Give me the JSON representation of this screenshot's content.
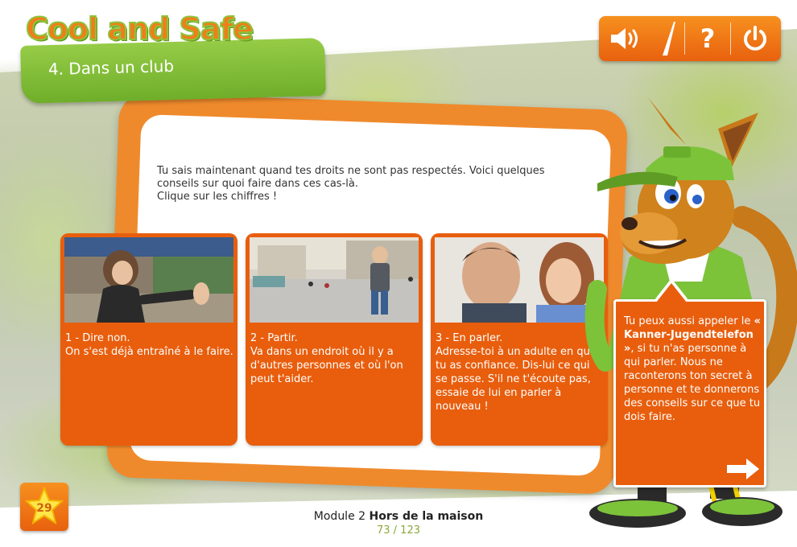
{
  "header": {
    "logo_text": "Cool and Safe",
    "section_title": "4. Dans un club"
  },
  "toolbar": {
    "sound_icon": "speaker-icon",
    "volume_icon": "volume-level-icon",
    "help_label": "?",
    "power_icon": "power-icon"
  },
  "intro": {
    "line1": "Tu sais maintenant quand tes droits ne sont pas respectés. Voici quelques conseils sur quoi faire dans ces cas-là.",
    "line2": "Clique sur les chiffres !"
  },
  "tiles": [
    {
      "title": "1 - Dire non.",
      "body": "On s'est déjà entraîné à le faire."
    },
    {
      "title": "2 - Partir.",
      "body": "Va dans un endroit où il y a d'autres personnes et où l'on peut t'aider."
    },
    {
      "title": "3 - En parler.",
      "body": "Adresse-toi à un adulte en qui tu as confiance. Dis-lui ce qui se passe. S'il ne t'écoute pas, essaie de lui en parler à nouveau !"
    }
  ],
  "bubble": {
    "text_before": "Tu peux aussi appeler le ",
    "highlight": "« Kanner-Jugendtelefon »",
    "text_after": ", si tu n'as personne à qui parler. Nous ne raconterons ton secret à personne et te donnerons des conseils sur ce que tu dois faire."
  },
  "footer": {
    "star_count": "29",
    "module_prefix": "Module 2",
    "module_name": "Hors de la maison",
    "page_indicator": "73 / 123"
  },
  "colors": {
    "orange": "#e85e0d",
    "green": "#7ab833"
  }
}
